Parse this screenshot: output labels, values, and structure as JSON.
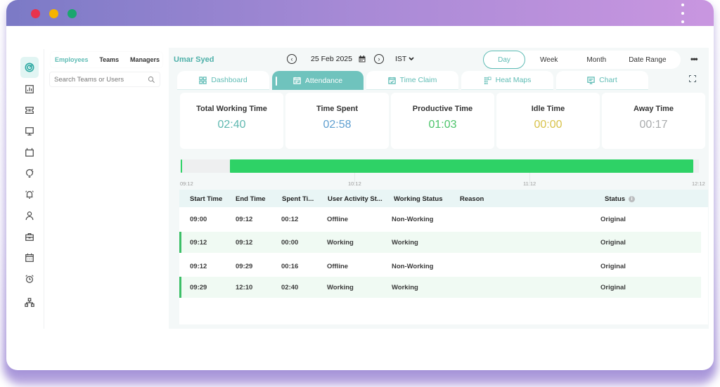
{
  "window": {
    "controls": [
      "close",
      "minimize",
      "maximize"
    ],
    "menu_icon": "kebab-menu-icon"
  },
  "rail": {
    "items": [
      {
        "name": "dashboard",
        "icon": "target-icon",
        "active": true
      },
      {
        "name": "reports",
        "icon": "bar-chart-icon",
        "active": false
      },
      {
        "name": "tickets",
        "icon": "ticket-icon",
        "active": false
      },
      {
        "name": "monitor",
        "icon": "monitor-icon",
        "active": false
      },
      {
        "name": "tv",
        "icon": "tv-icon",
        "active": false
      },
      {
        "name": "insights",
        "icon": "lightbulb-icon",
        "active": false
      },
      {
        "name": "alerts",
        "icon": "alarm-bell-icon",
        "active": false
      },
      {
        "name": "profile",
        "icon": "user-icon",
        "active": false
      },
      {
        "name": "projects",
        "icon": "briefcase-icon",
        "active": false
      },
      {
        "name": "calendar",
        "icon": "calendar-icon",
        "active": false
      },
      {
        "name": "timer",
        "icon": "alarm-clock-icon",
        "active": false
      },
      {
        "name": "org-chart",
        "icon": "hierarchy-icon",
        "active": false
      }
    ]
  },
  "people": {
    "tabs": [
      {
        "label": "Employees",
        "active": true
      },
      {
        "label": "Teams",
        "active": false
      },
      {
        "label": "Managers",
        "active": false
      }
    ],
    "search_placeholder": "Search Teams or Users"
  },
  "header": {
    "user_name": "Umar Syed",
    "date": "25 Feb 2025",
    "timezone": "IST",
    "ranges": [
      {
        "label": "Day",
        "active": true
      },
      {
        "label": "Week",
        "active": false
      },
      {
        "label": "Month",
        "active": false
      },
      {
        "label": "Date Range",
        "active": false
      }
    ],
    "more_label": "•••"
  },
  "tabs": [
    {
      "label": "Dashboard",
      "icon": "grid-icon",
      "active": false
    },
    {
      "label": "Attendance",
      "icon": "calendar-list-icon",
      "active": true
    },
    {
      "label": "Time Claim",
      "icon": "calendar-check-icon",
      "active": false
    },
    {
      "label": "Heat Maps",
      "icon": "heatmap-icon",
      "active": false
    },
    {
      "label": "Chart",
      "icon": "chart-board-icon",
      "active": false
    }
  ],
  "stats": [
    {
      "title": "Total Working Time",
      "value": "02:40",
      "color": "#5fb8b0"
    },
    {
      "title": "Time Spent",
      "value": "02:58",
      "color": "#5f9fd0"
    },
    {
      "title": "Productive Time",
      "value": "01:03",
      "color": "#4cc46a"
    },
    {
      "title": "Idle Time",
      "value": "00:00",
      "color": "#d8c24a"
    },
    {
      "title": "Away Time",
      "value": "00:17",
      "color": "#a9abad"
    }
  ],
  "timeline": {
    "ticks": [
      "09:12",
      "10:12",
      "11:12",
      "12:12"
    ],
    "range_minutes": [
      552,
      732
    ],
    "segments": [
      {
        "start": "09:12",
        "end": "09:12",
        "type": "working"
      },
      {
        "start": "09:29",
        "end": "12:10",
        "type": "working"
      }
    ],
    "working_color": "#2ed266"
  },
  "table": {
    "columns": [
      "Start Time",
      "End Time",
      "Spent Ti...",
      "User Activity St...",
      "Working Status",
      "Reason",
      "Status"
    ],
    "status_info_icon": "info-icon",
    "rows": [
      {
        "start": "09:00",
        "end": "09:12",
        "spent": "00:12",
        "activity": "Offline",
        "working_status": "Non-Working",
        "reason": "",
        "status": "Original",
        "highlight": false
      },
      {
        "start": "09:12",
        "end": "09:12",
        "spent": "00:00",
        "activity": "Working",
        "working_status": "Working",
        "reason": "",
        "status": "Original",
        "highlight": true
      },
      {
        "start": "09:12",
        "end": "09:29",
        "spent": "00:16",
        "activity": "Offline",
        "working_status": "Non-Working",
        "reason": "",
        "status": "Original",
        "highlight": false
      },
      {
        "start": "09:29",
        "end": "12:10",
        "spent": "02:40",
        "activity": "Working",
        "working_status": "Working",
        "reason": "",
        "status": "Original",
        "highlight": true
      }
    ]
  }
}
